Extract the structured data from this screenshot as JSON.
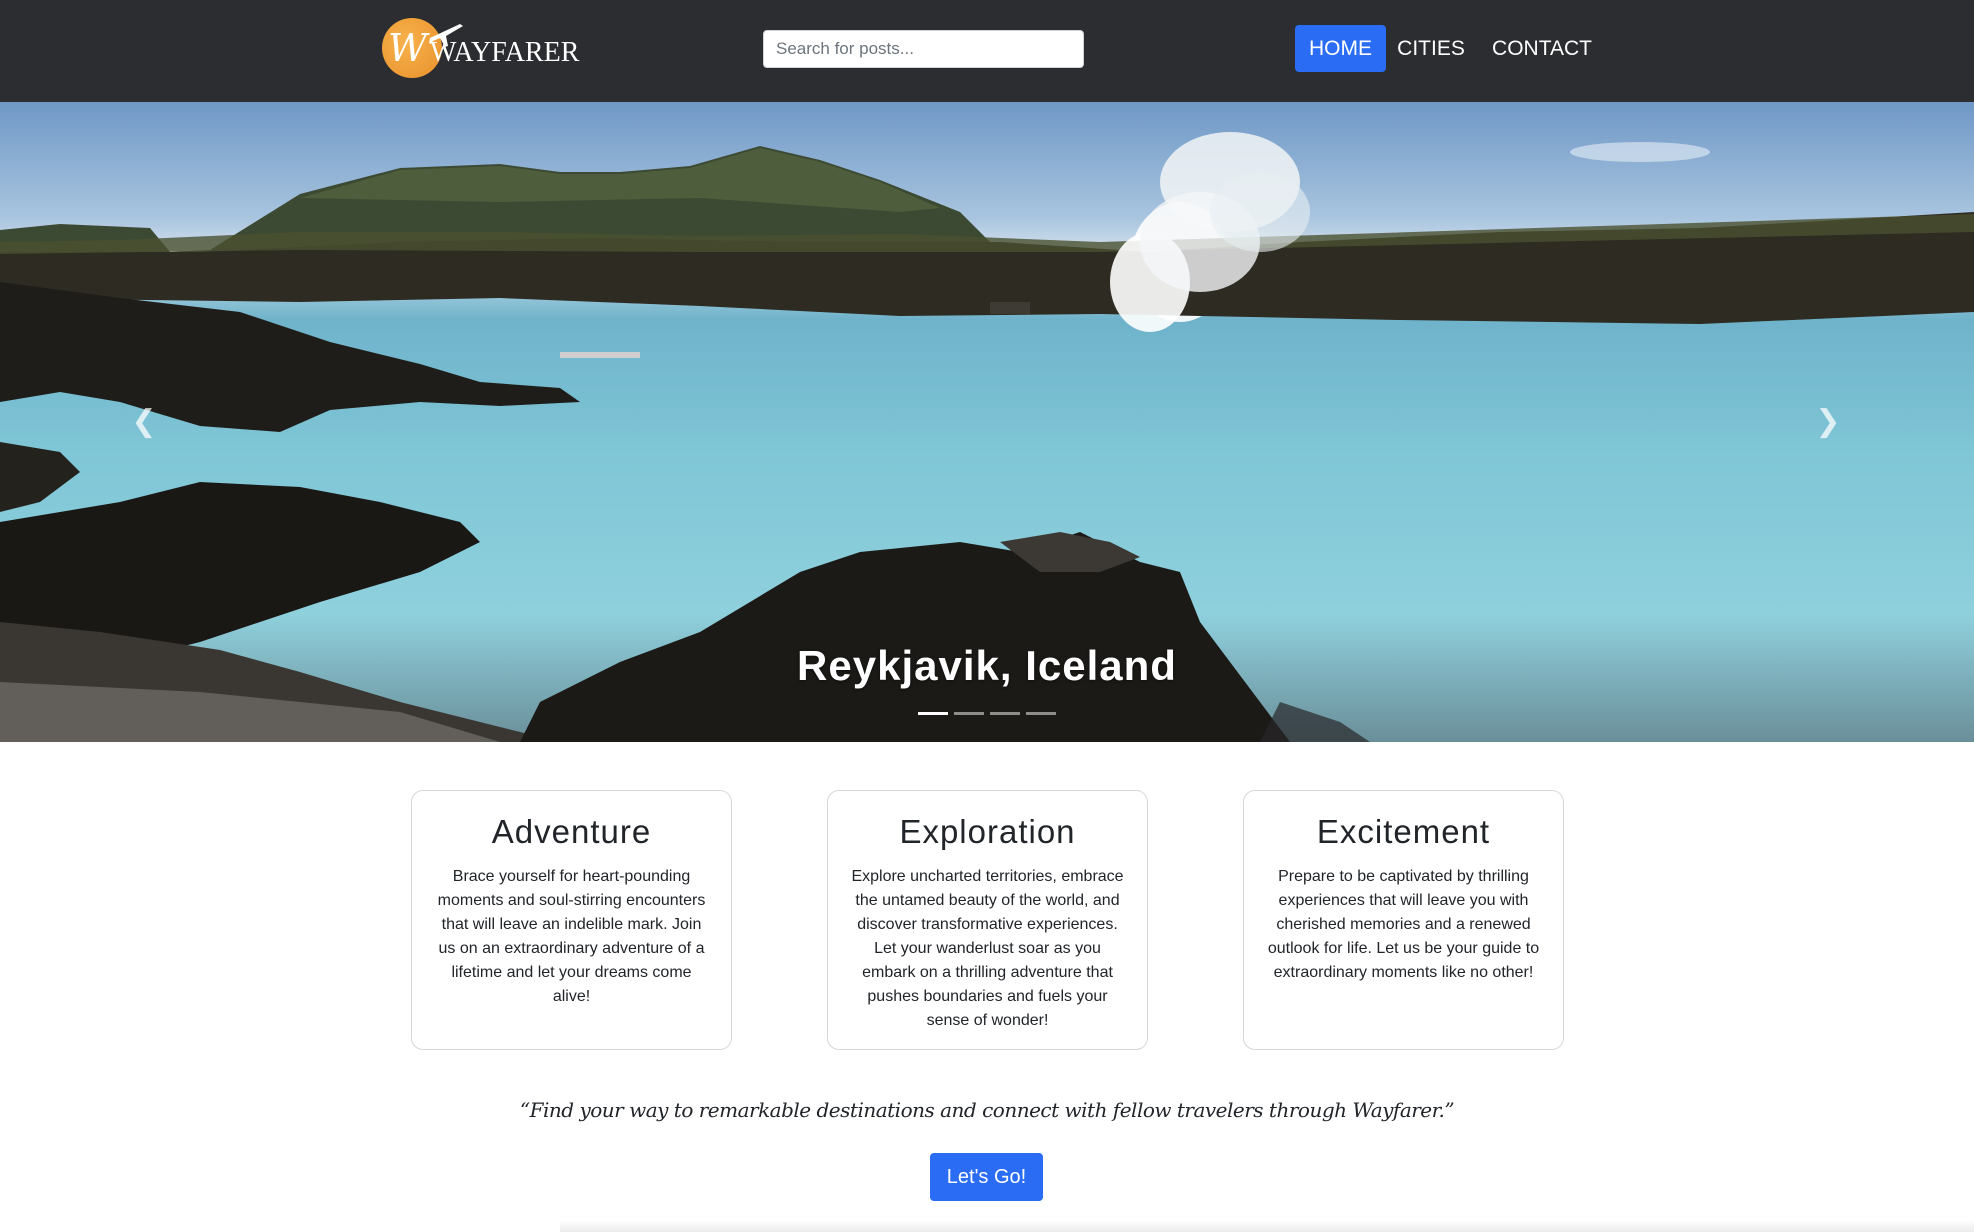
{
  "brand": {
    "logo_text": "WAYFARER",
    "logo_initial": "W",
    "accent": "#e8902a"
  },
  "search": {
    "placeholder": "Search for posts..."
  },
  "nav": {
    "items": [
      {
        "label": "HOME",
        "active": true
      },
      {
        "label": "CITIES"
      },
      {
        "label": "CONTACT"
      }
    ]
  },
  "hero": {
    "caption": "Reykjavik, Iceland",
    "slides_count": 4,
    "active_slide": 1,
    "prev_icon": "chevron-left-icon",
    "next_icon": "chevron-right-icon"
  },
  "cards": [
    {
      "title": "Adventure",
      "text": "Brace yourself for heart-pounding moments and soul-stirring encounters that will leave an indelible mark. Join us on an extraordinary adventure of a lifetime and let your dreams come alive!"
    },
    {
      "title": "Exploration",
      "text": "Explore uncharted territories, embrace the untamed beauty of the world, and discover transformative experiences. Let your wanderlust soar as you embark on a thrilling adventure that pushes boundaries and fuels your sense of wonder!"
    },
    {
      "title": "Excitement",
      "text": "Prepare to be captivated by thrilling experiences that will leave you with cherished memories and a renewed outlook for life. Let us be your guide to extraordinary moments like no other!"
    }
  ],
  "quote": "“Find your way to remarkable destinations and connect with fellow travelers through Wayfarer.”",
  "cta": {
    "label": "Let's Go!"
  },
  "colors": {
    "navbar": "#2b2d31",
    "primary": "#2a6df4"
  }
}
